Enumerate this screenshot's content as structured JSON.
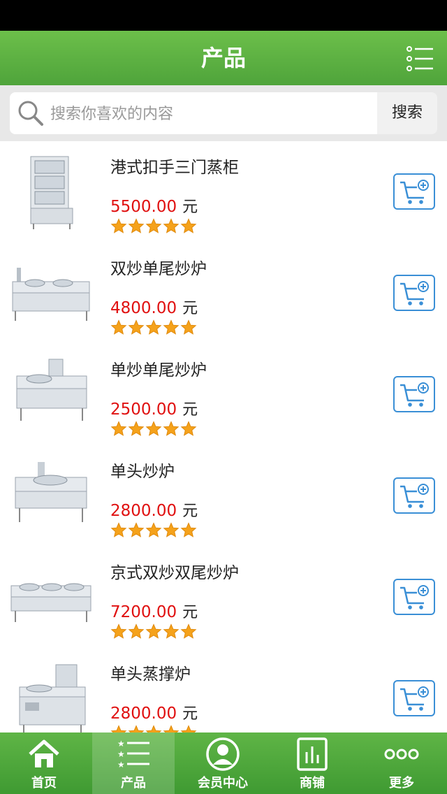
{
  "header": {
    "title": "产品"
  },
  "search": {
    "placeholder": "搜索你喜欢的内容",
    "button_label": "搜索"
  },
  "products": [
    {
      "name": "港式扣手三门蒸柜",
      "price": "5500.00",
      "unit": "元",
      "rating": 5
    },
    {
      "name": "双炒单尾炒炉",
      "price": "4800.00",
      "unit": "元",
      "rating": 5
    },
    {
      "name": "单炒单尾炒炉",
      "price": "2500.00",
      "unit": "元",
      "rating": 5
    },
    {
      "name": "单头炒炉",
      "price": "2800.00",
      "unit": "元",
      "rating": 5
    },
    {
      "name": "京式双炒双尾炒炉",
      "price": "7200.00",
      "unit": "元",
      "rating": 5
    },
    {
      "name": "单头蒸撑炉",
      "price": "2800.00",
      "unit": "元",
      "rating": 5
    }
  ],
  "tabbar": {
    "items": [
      {
        "label": "首页",
        "icon": "home-icon"
      },
      {
        "label": "产品",
        "icon": "list-icon",
        "active": true
      },
      {
        "label": "会员中心",
        "icon": "member-icon"
      },
      {
        "label": "商铺",
        "icon": "shop-icon"
      },
      {
        "label": "更多",
        "icon": "more-icon"
      }
    ]
  },
  "colors": {
    "brand": "#5aae41",
    "price": "#e01010",
    "star": "#f5a21b",
    "cart": "#3a8fd6"
  }
}
